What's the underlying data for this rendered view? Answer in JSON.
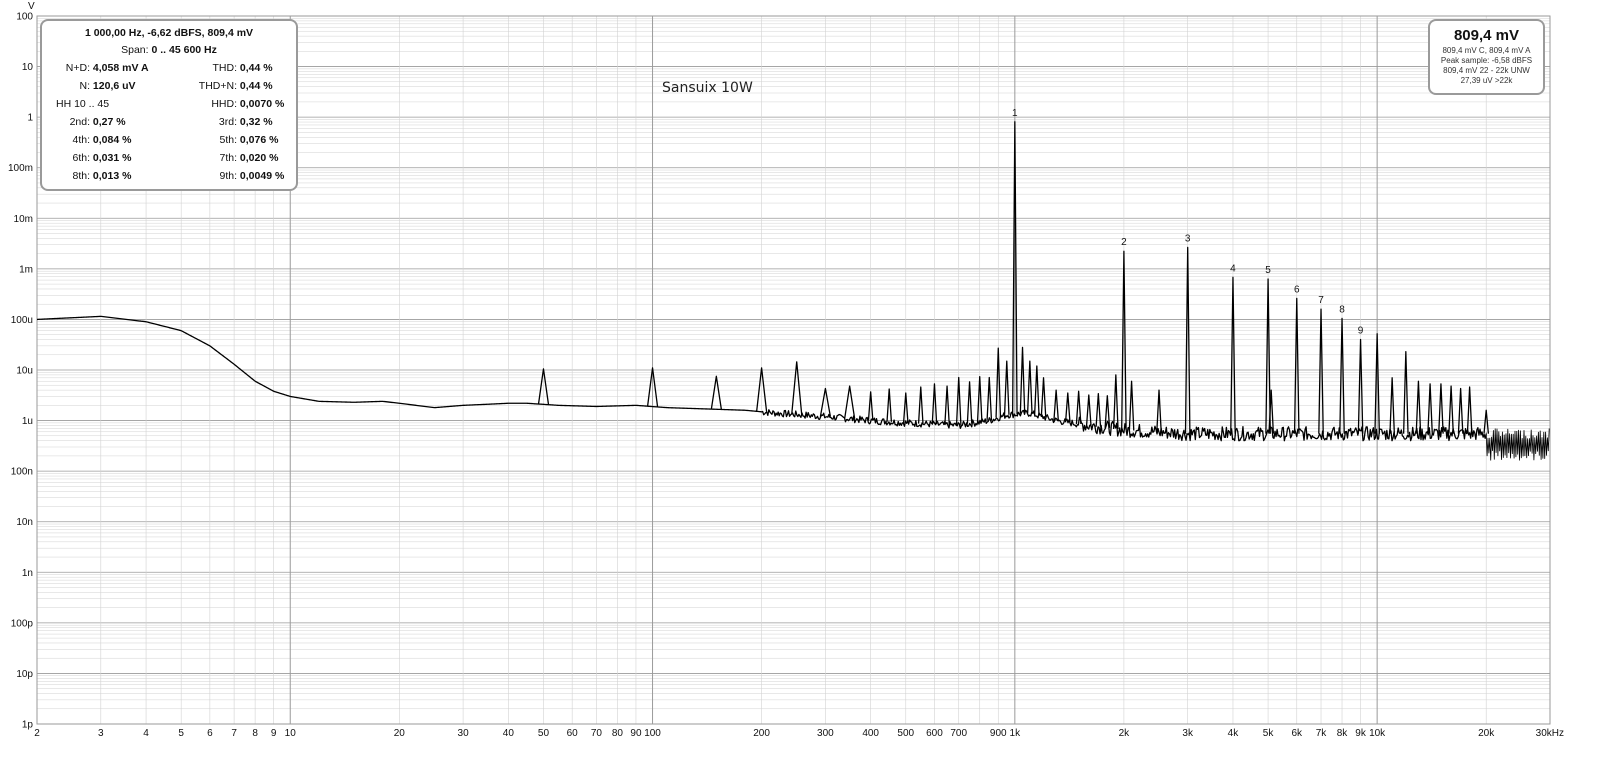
{
  "chart_data": {
    "type": "line",
    "title": "Sansuix 10W",
    "x_scale": "log",
    "y_scale": "log",
    "xlim": [
      2,
      30000
    ],
    "ylim": [
      1e-12,
      100
    ],
    "y_unit_label": "V",
    "x_ticks": [
      2,
      3,
      4,
      5,
      6,
      7,
      8,
      9,
      10,
      20,
      30,
      40,
      50,
      60,
      70,
      80,
      90,
      100,
      200,
      300,
      400,
      500,
      600,
      700,
      900,
      1000,
      2000,
      3000,
      4000,
      5000,
      6000,
      7000,
      8000,
      9000,
      10000,
      20000,
      30000
    ],
    "x_tick_labels": [
      "2",
      "3",
      "4",
      "5",
      "6",
      "7",
      "8",
      "9",
      "10",
      "20",
      "30",
      "40",
      "50",
      "60",
      "70",
      "80",
      "90",
      "100",
      "200",
      "300",
      "400",
      "500",
      "600",
      "700",
      "900",
      "1k",
      "2k",
      "3k",
      "4k",
      "5k",
      "6k",
      "7k",
      "8k",
      "9k",
      "10k",
      "20k",
      "30kHz"
    ],
    "x_minor": [
      800
    ],
    "y_ticks": [
      100,
      10,
      1,
      0.1,
      0.01,
      0.001,
      0.0001,
      1e-05,
      1e-06,
      1e-07,
      1e-08,
      1e-09,
      1e-10,
      1e-11,
      1e-12
    ],
    "y_tick_labels": [
      "100",
      "10",
      "1",
      "100m",
      "10m",
      "1m",
      "100u",
      "10u",
      "1u",
      "100n",
      "10n",
      "1n",
      "100p",
      "10p",
      "1p"
    ],
    "grid": true,
    "baseline": [
      [
        2,
        0.0001
      ],
      [
        3,
        0.000115
      ],
      [
        4,
        9e-05
      ],
      [
        5,
        6e-05
      ],
      [
        6,
        3e-05
      ],
      [
        7,
        1.3e-05
      ],
      [
        8,
        6e-06
      ],
      [
        9,
        3.8e-06
      ],
      [
        10,
        3e-06
      ],
      [
        12,
        2.4e-06
      ],
      [
        15,
        2.3e-06
      ],
      [
        18,
        2.4e-06
      ],
      [
        20,
        2.2e-06
      ],
      [
        25,
        1.8e-06
      ],
      [
        30,
        2e-06
      ],
      [
        35,
        2.1e-06
      ],
      [
        40,
        2.2e-06
      ],
      [
        45,
        2.2e-06
      ],
      [
        55,
        2e-06
      ],
      [
        70,
        1.9e-06
      ],
      [
        90,
        2e-06
      ],
      [
        110,
        1.8e-06
      ],
      [
        140,
        1.7e-06
      ],
      [
        180,
        1.6e-06
      ],
      [
        220,
        1.4e-06
      ],
      [
        300,
        1.2e-06
      ],
      [
        400,
        1e-06
      ],
      [
        500,
        9e-07
      ],
      [
        700,
        8e-07
      ],
      [
        850,
        1e-06
      ],
      [
        950,
        1.3e-06
      ],
      [
        1100,
        1.4e-06
      ],
      [
        1300,
        1e-06
      ],
      [
        1600,
        8e-07
      ],
      [
        2000,
        6.5e-07
      ],
      [
        3000,
        5.5e-07
      ],
      [
        5000,
        5.5e-07
      ],
      [
        10000,
        5.5e-07
      ],
      [
        20000,
        5.5e-07
      ],
      [
        30000,
        5.5e-07
      ]
    ],
    "noise_floor_above_20k": [
      1.6e-07,
      7e-07
    ],
    "peaks": [
      [
        50,
        1.05e-05
      ],
      [
        100,
        1.1e-05
      ],
      [
        150,
        7.5e-06
      ],
      [
        200,
        1.1e-05
      ],
      [
        250,
        1.45e-05
      ],
      [
        300,
        4.3e-06
      ],
      [
        350,
        4.8e-06
      ],
      [
        400,
        3.7e-06
      ],
      [
        450,
        4.2e-06
      ],
      [
        500,
        3.5e-06
      ],
      [
        550,
        4.6e-06
      ],
      [
        600,
        5.3e-06
      ],
      [
        650,
        4.8e-06
      ],
      [
        700,
        7.1e-06
      ],
      [
        750,
        5.8e-06
      ],
      [
        800,
        7.4e-06
      ],
      [
        850,
        7.1e-06
      ],
      [
        900,
        2.7e-05
      ],
      [
        950,
        1.5e-05
      ],
      [
        1000,
        0.8094
      ],
      [
        1050,
        2.8e-05
      ],
      [
        1100,
        1.5e-05
      ],
      [
        1150,
        1.2e-05
      ],
      [
        1200,
        7e-06
      ],
      [
        1300,
        4e-06
      ],
      [
        1400,
        3.5e-06
      ],
      [
        1500,
        3.8e-06
      ],
      [
        1600,
        3.2e-06
      ],
      [
        1700,
        3.4e-06
      ],
      [
        1800,
        3.1e-06
      ],
      [
        1900,
        8e-06
      ],
      [
        2000,
        0.00223
      ],
      [
        2100,
        6e-06
      ],
      [
        2500,
        4e-06
      ],
      [
        3000,
        0.00265
      ],
      [
        4000,
        0.00068
      ],
      [
        5000,
        0.00063
      ],
      [
        5100,
        4e-06
      ],
      [
        6000,
        0.00026
      ],
      [
        7000,
        0.00016
      ],
      [
        8000,
        0.000105
      ],
      [
        9000,
        4e-05
      ],
      [
        10000,
        5.2e-05
      ],
      [
        11000,
        7e-06
      ],
      [
        12000,
        2.3e-05
      ],
      [
        13000,
        6e-06
      ],
      [
        14000,
        5.3e-06
      ],
      [
        15000,
        5.3e-06
      ],
      [
        16000,
        4.8e-06
      ],
      [
        17000,
        4.3e-06
      ],
      [
        18000,
        4.6e-06
      ],
      [
        20000,
        1.6e-06
      ]
    ],
    "harmonic_labels": [
      {
        "label": "1",
        "freq": 1000,
        "value": 0.8094
      },
      {
        "label": "2",
        "freq": 2000,
        "value": 0.00223
      },
      {
        "label": "3",
        "freq": 3000,
        "value": 0.00265
      },
      {
        "label": "4",
        "freq": 4000,
        "value": 0.00068
      },
      {
        "label": "5",
        "freq": 5000,
        "value": 0.00063
      },
      {
        "label": "6",
        "freq": 6000,
        "value": 0.00026
      },
      {
        "label": "7",
        "freq": 7000,
        "value": 0.00016
      },
      {
        "label": "8",
        "freq": 8000,
        "value": 0.000105
      },
      {
        "label": "9",
        "freq": 9000,
        "value": 4e-05
      }
    ]
  },
  "stats_panel": {
    "header": "1 000,00 Hz, -6,62 dBFS, 809,4 mV",
    "span_label": "Span:",
    "span_value": "0 .. 45 600 Hz",
    "rows": [
      {
        "k1": "N+D:",
        "v1": "4,058 mV A",
        "k2": "THD:",
        "v2": "0,44 %"
      },
      {
        "k1": "N:",
        "v1": "120,6 uV",
        "k2": "THD+N:",
        "v2": "0,44 %"
      },
      {
        "k1": "HH 10 .. 45",
        "v1": "",
        "k2": "HHD:",
        "v2": "0,0070 %"
      },
      {
        "k1": "2nd:",
        "v1": "0,27 %",
        "k2": "3rd:",
        "v2": "0,32 %"
      },
      {
        "k1": "4th:",
        "v1": "0,084 %",
        "k2": "5th:",
        "v2": "0,076 %"
      },
      {
        "k1": "6th:",
        "v1": "0,031 %",
        "k2": "7th:",
        "v2": "0,020 %"
      },
      {
        "k1": "8th:",
        "v1": "0,013 %",
        "k2": "9th:",
        "v2": "0,0049 %"
      }
    ]
  },
  "meter_panel": {
    "value": "809,4 mV",
    "lines": [
      "809,4 mV C, 809,4 mV A",
      "Peak sample: -6,58 dBFS",
      "809,4 mV 22 - 22k UNW",
      "27,39 uV >22k"
    ]
  },
  "colors": {
    "trace": "#000000",
    "grid_major": "#9a9a9a",
    "grid_minor": "#d2d2d2",
    "panel_border": "#9a9a9a"
  }
}
